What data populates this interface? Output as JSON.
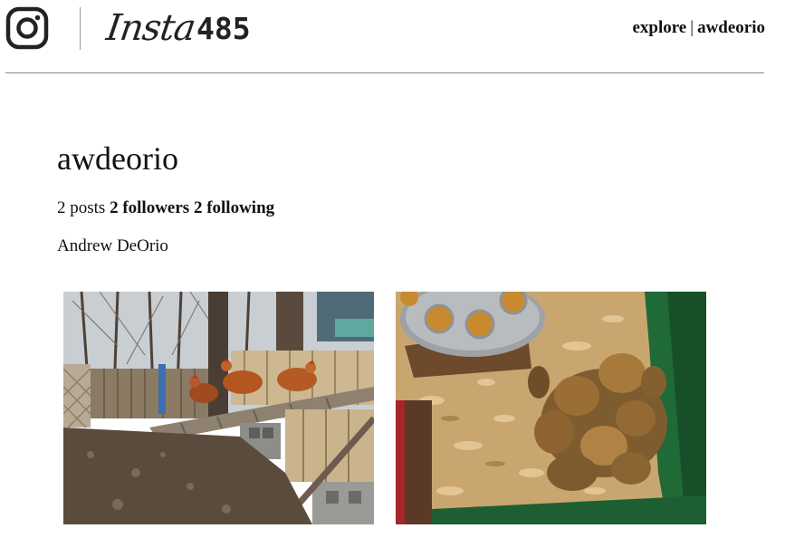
{
  "header": {
    "brand_script": "Insta",
    "brand_number": "485",
    "nav": {
      "explore_label": "explore",
      "separator": "|",
      "user_label": "awdeorio"
    }
  },
  "profile": {
    "username": "awdeorio",
    "posts_label": "2 posts",
    "followers_label": "2 followers",
    "following_label": "2 following",
    "full_name": "Andrew DeOrio"
  },
  "posts": [
    {
      "icon": "chickens-in-yard-photo"
    },
    {
      "icon": "baby-chicks-in-bin-photo"
    }
  ],
  "colors": {
    "text": "#111111",
    "rule": "#8a8a8a",
    "background": "#ffffff"
  }
}
